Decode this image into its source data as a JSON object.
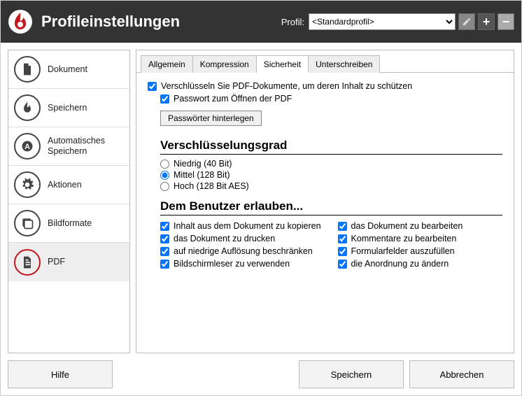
{
  "header": {
    "title": "Profileinstellungen",
    "profile_label": "Profil:",
    "profile_selected": "<Standardprofil>"
  },
  "sidebar": {
    "items": [
      {
        "label": "Dokument"
      },
      {
        "label": "Speichern"
      },
      {
        "label": "Automatisches Speichern"
      },
      {
        "label": "Aktionen"
      },
      {
        "label": "Bildformate"
      },
      {
        "label": "PDF"
      }
    ]
  },
  "tabs": {
    "general": "Allgemein",
    "compression": "Kompression",
    "security": "Sicherheit",
    "sign": "Unterschreiben"
  },
  "security": {
    "encrypt": "Verschlüsseln Sie PDF-Dokumente, um deren Inhalt zu schützen",
    "open_password": "Passwort zum Öffnen der PDF",
    "store_passwords": "Passwörter hinterlegen",
    "level_heading": "Verschlüsselungsgrad",
    "level_low": "Niedrig (40 Bit)",
    "level_medium": "Mittel (128 Bit)",
    "level_high": "Hoch (128 Bit AES)",
    "allow_heading": "Dem Benutzer erlauben...",
    "perm_copy": "Inhalt aus dem Dokument zu kopieren",
    "perm_print": "das Dokument zu drucken",
    "perm_lowres": "auf niedrige Auflösung beschränken",
    "perm_screenreader": "Bildschirmleser zu verwenden",
    "perm_edit": "das Dokument zu bearbeiten",
    "perm_comments": "Kommentare zu bearbeiten",
    "perm_forms": "Formularfelder auszufüllen",
    "perm_order": "die Anordnung zu ändern"
  },
  "footer": {
    "help": "Hilfe",
    "save": "Speichern",
    "cancel": "Abbrechen"
  }
}
